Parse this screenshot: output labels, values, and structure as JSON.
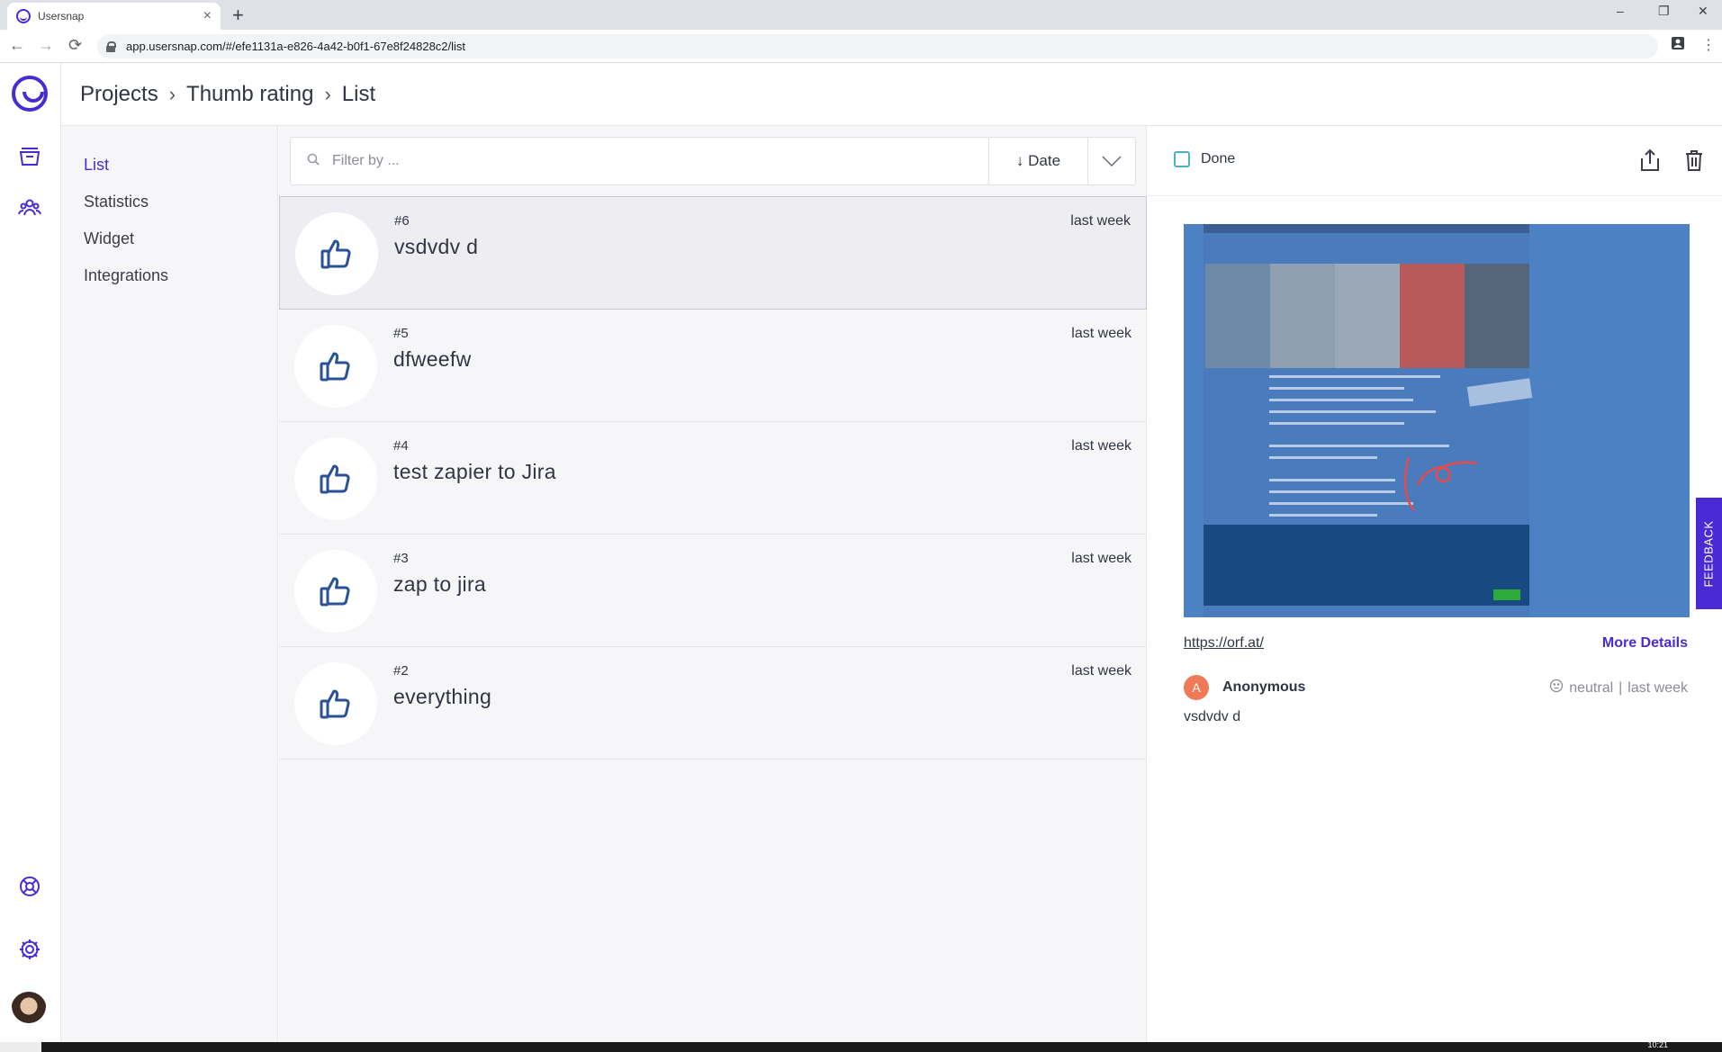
{
  "browser": {
    "tab_title": "Usersnap",
    "tab_close": "×",
    "new_tab": "+",
    "url": "app.usersnap.com/#/efe1131a-e826-4a42-b0f1-67e8f24828c2/list",
    "minimize": "–",
    "restore": "❐",
    "close": "✕",
    "back": "←",
    "forward": "→",
    "reload": "⟳",
    "menu": "⋮"
  },
  "breadcrumb": {
    "items": [
      "Projects",
      "Thumb rating",
      "List"
    ],
    "separator": "›"
  },
  "subnav": {
    "items": [
      "List",
      "Statistics",
      "Widget",
      "Integrations"
    ],
    "active": "List"
  },
  "list": {
    "filter_placeholder": "Filter by ...",
    "sort_label": "↓ Date",
    "rows": [
      {
        "num": "#6",
        "title": "vsdvdv d",
        "time": "last week",
        "selected": true
      },
      {
        "num": "#5",
        "title": "dfweefw",
        "time": "last week"
      },
      {
        "num": "#4",
        "title": "test zapier to Jira",
        "time": "last week"
      },
      {
        "num": "#3",
        "title": "zap to jira",
        "time": "last week"
      },
      {
        "num": "#2",
        "title": "everything",
        "time": "last week"
      }
    ]
  },
  "detail": {
    "done_label": "Done",
    "url_link": "https://orf.at/",
    "more_details": "More Details",
    "author_initial": "A",
    "author_name": "Anonymous",
    "rating": "neutral",
    "time": "last week",
    "meta_separator": "|",
    "comment": "vsdvdv d"
  },
  "feedback_tab": "FEEDBACK",
  "taskbar": {
    "clock": "10:21"
  },
  "colors": {
    "brand": "#4a2bd3",
    "icon_blue": "#2a5298",
    "avatar": "#f07a55"
  },
  "icons": {
    "rail": [
      "usersnap-logo-icon",
      "projects-icon",
      "team-icon",
      "help-icon",
      "settings-icon",
      "user-avatar"
    ],
    "row": "thumbs-up-icon",
    "detail": [
      "share-icon",
      "trash-icon"
    ]
  }
}
